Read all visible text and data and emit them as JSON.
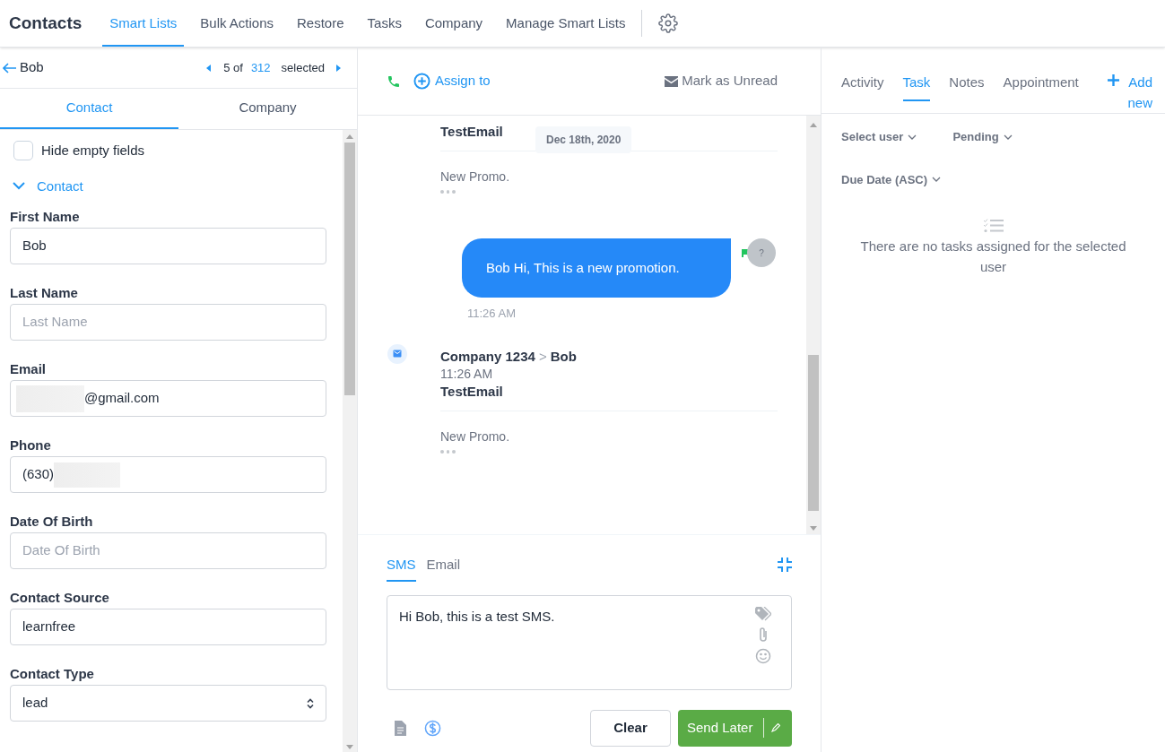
{
  "nav": {
    "title": "Contacts",
    "tabs": [
      {
        "label": "Smart Lists",
        "selected": true
      },
      {
        "label": "Bulk Actions",
        "selected": false
      },
      {
        "label": "Restore",
        "selected": false
      },
      {
        "label": "Tasks",
        "selected": false
      },
      {
        "label": "Company",
        "selected": false
      },
      {
        "label": "Manage Smart Lists",
        "selected": false
      }
    ]
  },
  "contact_panel": {
    "name": "Bob",
    "pager": {
      "position": "5 of",
      "total": "312",
      "suffix": "selected"
    },
    "tabs": [
      {
        "label": "Contact",
        "selected": true
      },
      {
        "label": "Company",
        "selected": false
      }
    ],
    "hide_empty": {
      "label": "Hide empty fields",
      "checked": false
    },
    "section": {
      "label": "Contact",
      "expanded": true
    },
    "fields": [
      {
        "kind": "text",
        "label": "First Name",
        "value": "Bob"
      },
      {
        "kind": "text",
        "label": "Last Name",
        "placeholder": "Last Name"
      },
      {
        "kind": "text",
        "label": "Email",
        "value": "@gmail.com",
        "blurred_prefix": true
      },
      {
        "kind": "text",
        "label": "Phone",
        "value": "(630)",
        "blurred_suffix": true
      },
      {
        "kind": "text",
        "label": "Date Of Birth",
        "placeholder": "Date Of Birth"
      },
      {
        "kind": "text",
        "label": "Contact Source",
        "value": "learnfree"
      },
      {
        "kind": "select",
        "label": "Contact Type",
        "value": "lead"
      }
    ]
  },
  "conversation": {
    "assign": "Assign to",
    "mark_unread": "Mark as Unread",
    "messages": [
      {
        "kind": "email",
        "subject": "TestEmail",
        "date_badge": "Dec 18th, 2020",
        "body": "New Promo."
      },
      {
        "kind": "sms",
        "text": "Bob Hi, This is a new promotion.",
        "avatar": "?",
        "time": "11:26 AM"
      },
      {
        "kind": "email",
        "from": "Company 1234",
        "separator": ">",
        "to": "Bob",
        "time": "11:26 AM",
        "subject": "TestEmail",
        "body": "New Promo."
      }
    ],
    "composer": {
      "tabs": [
        {
          "label": "SMS",
          "selected": true
        },
        {
          "label": "Email",
          "selected": false
        }
      ],
      "text": "Hi Bob, this is a test SMS.",
      "clear": "Clear",
      "send": "Send Later"
    }
  },
  "task_panel": {
    "tabs": [
      {
        "label": "Activity",
        "selected": false
      },
      {
        "label": "Task",
        "selected": true
      },
      {
        "label": "Notes",
        "selected": false
      },
      {
        "label": "Appointment",
        "selected": false
      }
    ],
    "add": "Add new",
    "filters": [
      "Select user",
      "Pending"
    ],
    "sort": "Due Date (ASC)",
    "empty": "There are no tasks assigned for the selected user"
  }
}
